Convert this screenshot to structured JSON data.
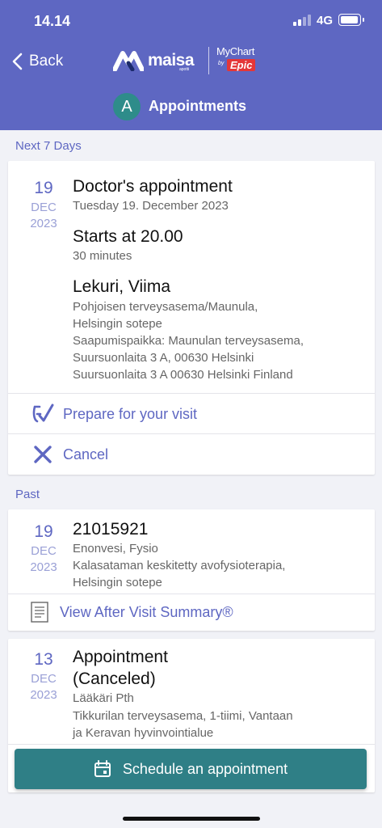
{
  "status_bar": {
    "time": "14.14",
    "network": "4G"
  },
  "header": {
    "back_label": "Back",
    "logo_text": "maisa",
    "logo_sub": "apotti",
    "mychart_text": "MyChart",
    "mychart_by": "by",
    "mychart_epic": "Epic",
    "avatar_letter": "A",
    "title": "Appointments"
  },
  "sections": {
    "upcoming": "Next 7 Days",
    "past": "Past"
  },
  "upcoming_appointment": {
    "day": "19",
    "month": "DEC",
    "year": "2023",
    "title": "Doctor's appointment",
    "date_text": "Tuesday 19. December 2023",
    "starts": "Starts at 20.00",
    "duration": "30 minutes",
    "provider": "Lekuri, Viima",
    "details": [
      "Pohjoisen terveysasema/Maunula,",
      "Helsingin sotepe",
      "Saapumispaikka: Maunulan terveysasema,",
      "Suursuonlaita 3 A, 00630 Helsinki",
      "Suursuonlaita 3 A 00630 Helsinki Finland"
    ],
    "actions": {
      "prepare": "Prepare for your visit",
      "cancel": "Cancel"
    }
  },
  "past_appointments": [
    {
      "day": "19",
      "month": "DEC",
      "year": "2023",
      "title": "21015921",
      "details": [
        "Enonvesi, Fysio",
        "Kalasataman  keskitetty avofysioterapia,",
        "Helsingin sotepe"
      ],
      "action": "View After Visit Summary®"
    },
    {
      "day": "13",
      "month": "DEC",
      "year": "2023",
      "title_line1": "Appointment",
      "title_line2": "(Canceled)",
      "details": [
        "Lääkäri Pth",
        "Tikkurilan terveysasema, 1-tiimi, Vantaan",
        "ja Keravan hyvinvointialue"
      ]
    }
  ],
  "schedule_button": "Schedule an appointment",
  "colors": {
    "header": "#5e67c2",
    "accent": "#5e67c2",
    "button": "#2f7f86",
    "avatar": "#2e8c8a"
  }
}
